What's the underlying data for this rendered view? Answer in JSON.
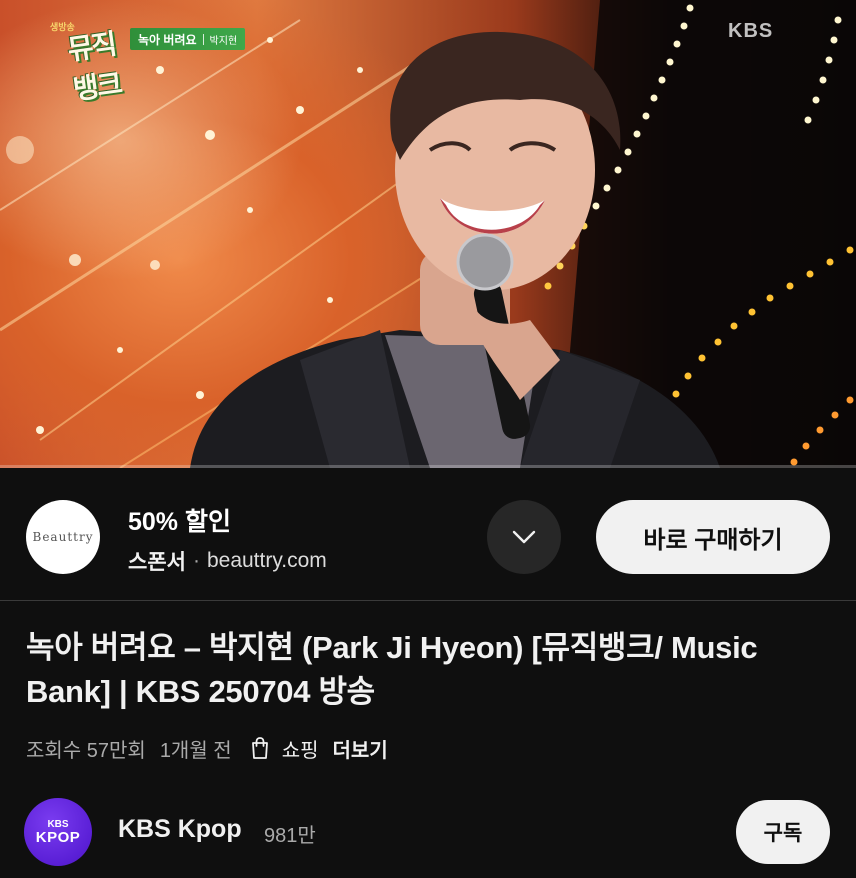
{
  "video": {
    "show_logo_small": "생방송",
    "show_logo": "뮤직뱅크",
    "lower_third_song": "녹아 버려요",
    "lower_third_artist": "박지현",
    "broadcaster_bug": "KBS",
    "progress_fraction": 0.0
  },
  "ad": {
    "logo_text": "Beauttry",
    "headline": "50% 할인",
    "sponsor_label": "스폰서",
    "separator": "·",
    "domain": "beauttry.com",
    "expand_icon": "chevron-down-icon",
    "cta_label": "바로 구매하기"
  },
  "video_info": {
    "title": "녹아 버려요 – 박지현 (Park Ji Hyeon) [뮤직뱅크/ Music Bank] | KBS 250704 방송",
    "views": "조회수 57만회",
    "age": "1개월 전",
    "shop_icon": "shopping-bag-icon",
    "shopping_label": "쇼핑",
    "more_label": "더보기"
  },
  "channel": {
    "avatar_line1": "KBS",
    "avatar_line2": "KPOP",
    "name": "KBS Kpop",
    "subscribers": "981만",
    "subscribe_label": "구독",
    "avatar_color": "#5a1fd6"
  },
  "colors": {
    "background": "#0f0f0f",
    "button_light": "#f1f1f1",
    "button_dark": "#272727",
    "secondary_text": "#aaaaaa"
  }
}
